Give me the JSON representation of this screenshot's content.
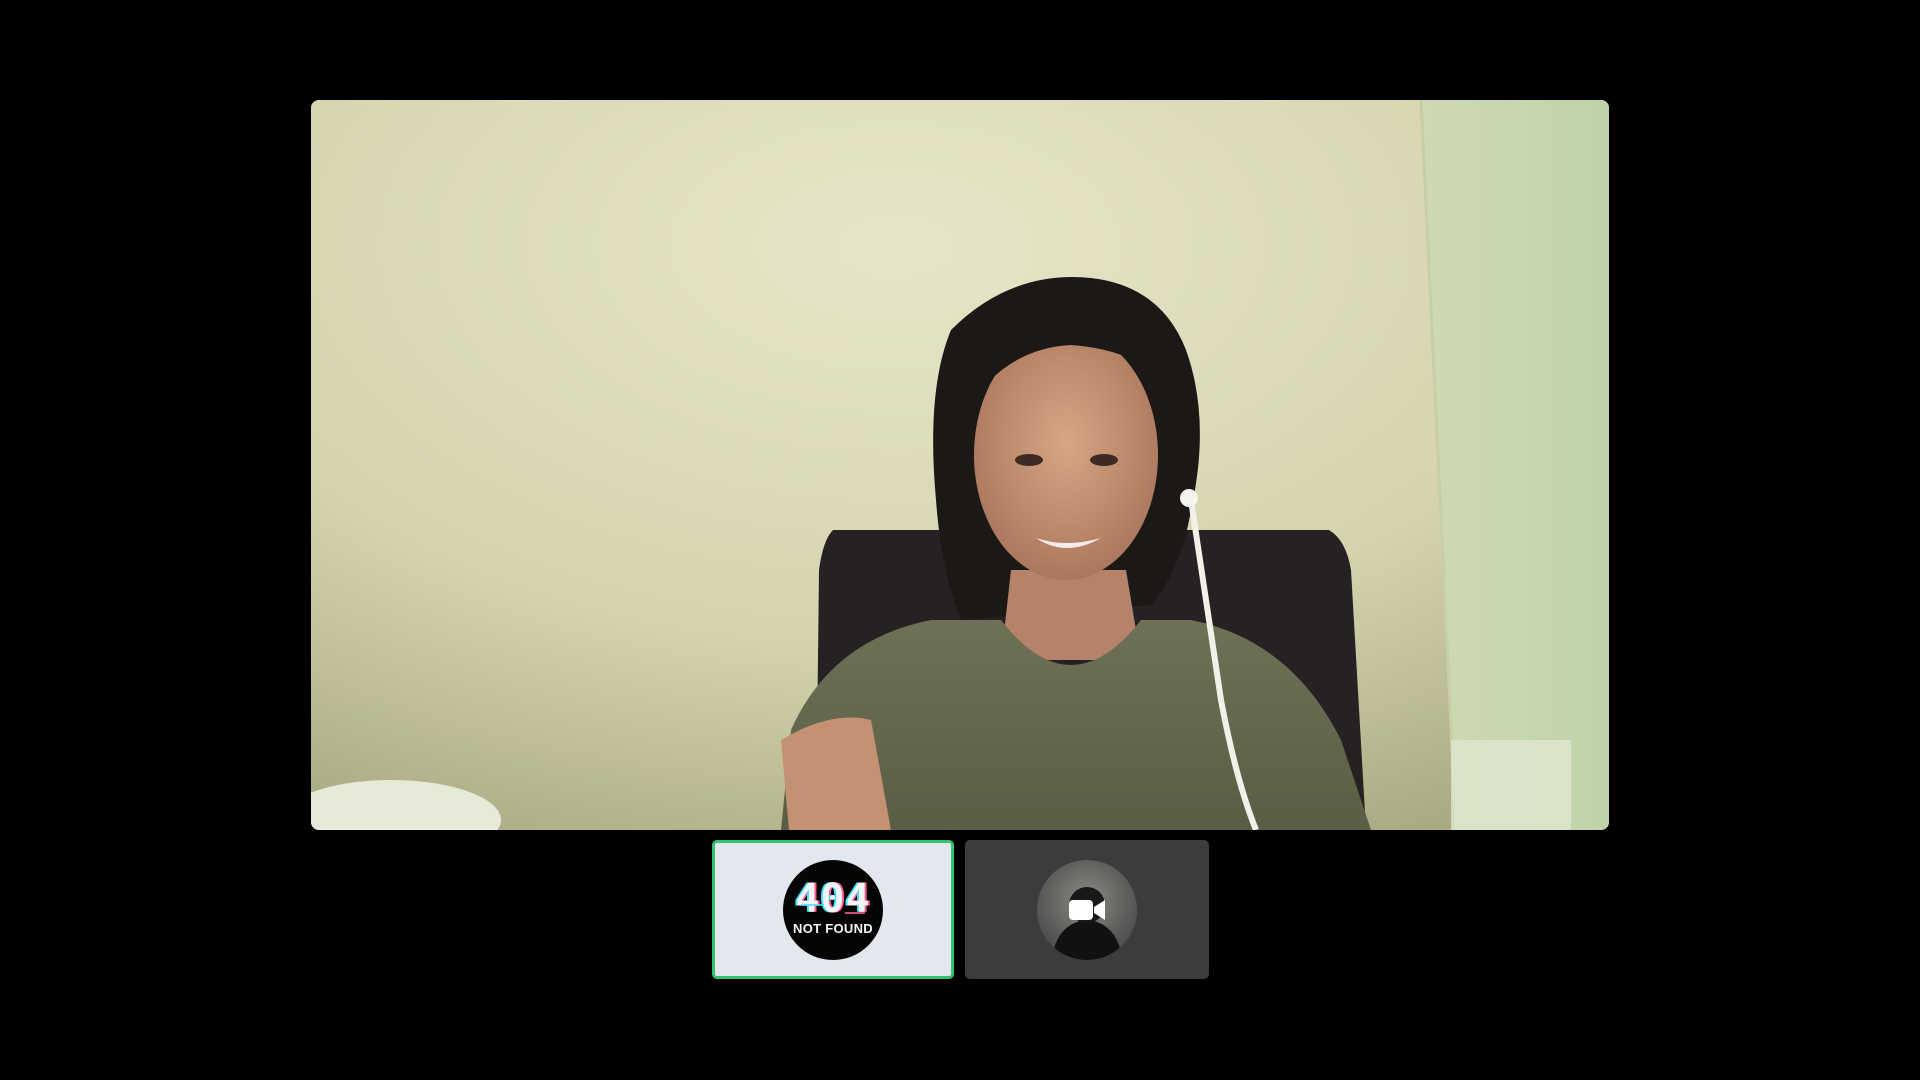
{
  "call": {
    "main_participant": {
      "video": "live-camera-feed"
    },
    "thumbnails": [
      {
        "role": "self",
        "active": true,
        "highlight_color": "#35c36f",
        "avatar_text_big": "404",
        "avatar_text_small": "NOT FOUND",
        "avatar_icon": "404-not-found-avatar"
      },
      {
        "role": "participant",
        "active": false,
        "avatar_icon": "profile-avatar",
        "status_icon": "video-camera-icon"
      }
    ]
  },
  "colors": {
    "background": "#000000",
    "active_border": "#35c36f",
    "self_tile_bg": "#e3e7ef",
    "other_tile_bg": "#3c3c3c"
  }
}
